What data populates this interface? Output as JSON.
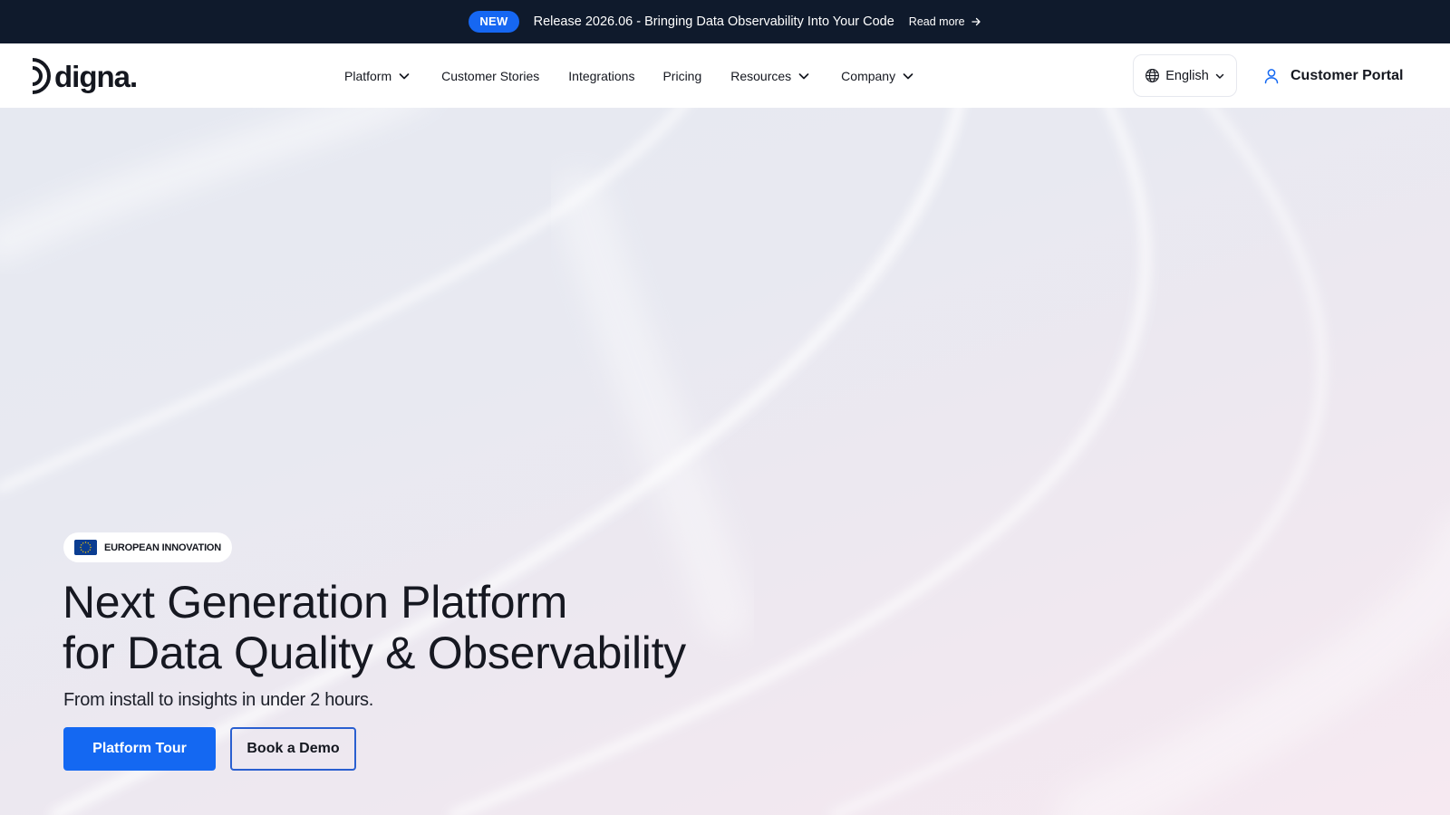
{
  "announcement": {
    "badge": "NEW",
    "message": "Release 2026.06 - Bringing Data Observability Into Your Code",
    "link_label": "Read more"
  },
  "header": {
    "logo_text": "digna.",
    "nav": [
      {
        "label": "Platform",
        "has_dropdown": true
      },
      {
        "label": "Customer Stories",
        "has_dropdown": false
      },
      {
        "label": "Integrations",
        "has_dropdown": false
      },
      {
        "label": "Pricing",
        "has_dropdown": false
      },
      {
        "label": "Resources",
        "has_dropdown": true
      },
      {
        "label": "Company",
        "has_dropdown": true
      }
    ],
    "language": "English",
    "portal_label": "Customer Portal"
  },
  "hero": {
    "badge_label": "EUROPEAN INNOVATION",
    "headline_line1": "Next Generation Platform",
    "headline_line2": "for Data Quality & Observability",
    "subheadline": "From install to insights in under 2 hours.",
    "primary_cta": "Platform Tour",
    "secondary_cta": "Book a Demo"
  },
  "colors": {
    "accent": "#1468f2",
    "announcement_bg": "#0f1a2c",
    "eu_flag_blue": "#0b3d91",
    "text_dark": "#14171f"
  },
  "icons": {
    "read_more": "arrow-right-icon",
    "dropdown": "chevron-down-icon",
    "language": "globe-icon",
    "portal": "user-icon",
    "flag": "eu-flag-icon"
  }
}
